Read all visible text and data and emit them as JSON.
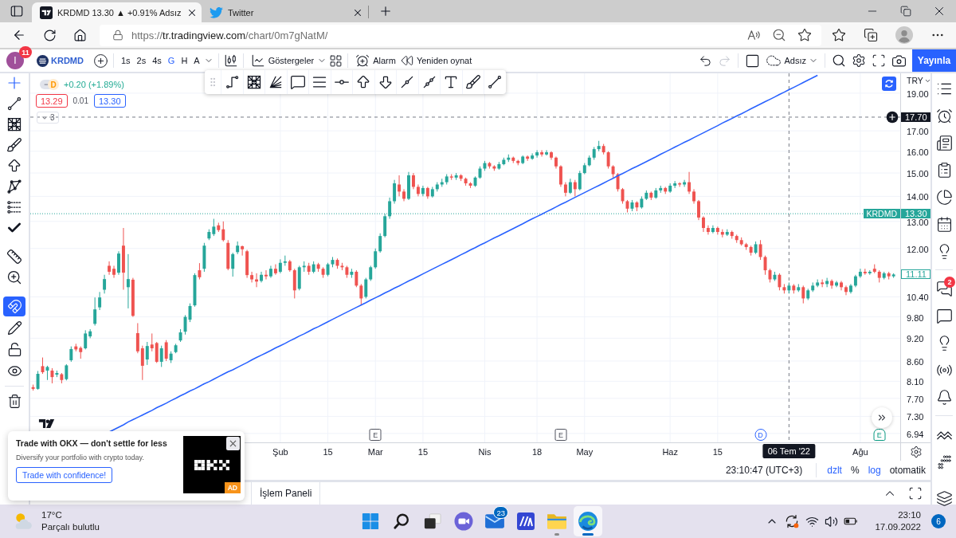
{
  "browser": {
    "tabs": [
      {
        "kind": "tradingview",
        "title": "KRDMD 13.30 ▲ +0.91% Adsız",
        "selected": true
      },
      {
        "kind": "twitter",
        "title": "Twitter",
        "selected": false
      }
    ],
    "address": {
      "scheme": "https://",
      "host": "tr.tradingview.com",
      "path": "/chart/0m7gNatM/"
    }
  },
  "toolbar": {
    "user": {
      "initial": "I",
      "badge": "11"
    },
    "symbol": "KRDMD",
    "intervals": [
      {
        "label": "1s",
        "selected": false
      },
      {
        "label": "2s",
        "selected": false
      },
      {
        "label": "4s",
        "selected": false
      },
      {
        "label": "G",
        "selected": true
      },
      {
        "label": "H",
        "selected": false
      },
      {
        "label": "A",
        "selected": false
      }
    ],
    "indicators": "Göstergeler",
    "alarm": "Alarm",
    "replay": "Yeniden oynat",
    "history": [
      {
        "kind": "undo",
        "disabled": false
      },
      {
        "kind": "redo",
        "disabled": true
      }
    ],
    "layout": "Adsız",
    "publish": "Yayınla"
  },
  "left_toolbar": {
    "groups": [
      {
        "tools": [
          {
            "kind": "crosshair",
            "selected": true
          },
          {
            "kind": "trend-line",
            "selected": false
          },
          {
            "kind": "fib-grid",
            "selected": false
          },
          {
            "kind": "brush",
            "selected": false
          },
          {
            "kind": "arrow",
            "selected": false
          },
          {
            "kind": "pattern",
            "selected": false
          },
          {
            "kind": "projection",
            "selected": false
          },
          {
            "kind": "check",
            "selected": false
          }
        ]
      },
      {
        "tools": [
          {
            "kind": "ruler",
            "selected": false
          },
          {
            "kind": "zoom",
            "selected": false
          }
        ]
      },
      {
        "tools": [
          {
            "kind": "magnet",
            "on": true
          },
          {
            "kind": "pencil-lock",
            "on": false
          },
          {
            "kind": "lock",
            "on": false
          },
          {
            "kind": "eye",
            "on": false
          }
        ]
      }
    ]
  },
  "chart": {
    "legend": {
      "status": "D",
      "change": "+0.20 (+1.89%)",
      "bid": "13.29",
      "spread": "0.01",
      "ask": "13.30",
      "collapsed_count": "3"
    },
    "currency": "TRY",
    "symbol_tag": "KRDMD",
    "last_value": "11.11",
    "crosshair_date": "06 Tem '22",
    "chart_data": {
      "type": "candlestick",
      "log": true,
      "grid": true,
      "ylim": [
        6.76,
        20.15
      ],
      "yticks": [
        {
          "value": 19,
          "label": "19.00"
        },
        {
          "value": 17,
          "label": "17.00"
        },
        {
          "value": 16,
          "label": "16.00"
        },
        {
          "value": 15,
          "label": "15.00"
        },
        {
          "value": 14,
          "label": "14.00"
        },
        {
          "value": 13,
          "label": "13.00"
        },
        {
          "value": 12,
          "label": "12.00"
        },
        {
          "value": 10.4,
          "label": "10.40"
        },
        {
          "value": 9.8,
          "label": "9.80"
        },
        {
          "value": 9.2,
          "label": "9.20"
        },
        {
          "value": 8.6,
          "label": "8.60"
        },
        {
          "value": 8.1,
          "label": "8.10"
        },
        {
          "value": 7.7,
          "label": "7.70"
        },
        {
          "value": 7.3,
          "label": "7.30"
        },
        {
          "value": 6.94,
          "label": "6.94"
        }
      ],
      "categories": [
        null,
        null,
        null,
        null,
        null,
        null,
        null,
        null,
        null,
        null,
        null,
        null,
        null,
        null,
        null,
        null,
        null,
        null,
        null,
        null,
        null,
        null,
        null,
        null,
        null,
        null,
        null,
        null,
        null,
        null,
        null,
        null,
        null,
        null,
        null,
        null,
        null,
        null,
        null,
        null,
        null,
        null,
        null,
        null,
        null,
        null,
        null,
        null,
        null,
        null,
        null,
        null,
        "Şub",
        null,
        null,
        null,
        null,
        null,
        null,
        null,
        null,
        null,
        "15",
        null,
        null,
        null,
        null,
        null,
        null,
        null,
        null,
        null,
        "Mar",
        null,
        null,
        null,
        null,
        null,
        null,
        null,
        null,
        null,
        "15",
        null,
        null,
        null,
        null,
        null,
        null,
        null,
        null,
        null,
        null,
        null,
        null,
        "Nis",
        null,
        null,
        null,
        null,
        null,
        null,
        null,
        null,
        null,
        null,
        "18",
        null,
        null,
        null,
        null,
        null,
        null,
        null,
        null,
        null,
        "May",
        null,
        null,
        null,
        null,
        null,
        null,
        null,
        null,
        null,
        null,
        null,
        null,
        null,
        null,
        null,
        null,
        null,
        "Haz",
        null,
        null,
        null,
        null,
        null,
        null,
        null,
        null,
        null,
        "15",
        null,
        null,
        null,
        null,
        null,
        null,
        null,
        null,
        null,
        null,
        null,
        null,
        null,
        null,
        null,
        null,
        null,
        null,
        null,
        null,
        null,
        null,
        null,
        null,
        null,
        null,
        null,
        null,
        null,
        "Ağu",
        null,
        null,
        null,
        null,
        null,
        null,
        null
      ],
      "ohlc": [
        [
          7.96,
          8.02,
          7.88,
          7.92
        ],
        [
          7.92,
          8.35,
          7.9,
          8.28
        ],
        [
          8.47,
          8.69,
          8.28,
          8.32
        ],
        [
          8.36,
          8.48,
          8.13,
          8.45
        ],
        [
          8.36,
          8.42,
          8.05,
          8.2
        ],
        [
          8.26,
          8.36,
          8.2,
          8.3
        ],
        [
          8.27,
          8.3,
          8.05,
          8.13
        ],
        [
          8.15,
          8.52,
          8.12,
          8.49
        ],
        [
          8.62,
          8.98,
          8.58,
          8.91
        ],
        [
          8.98,
          9.05,
          8.85,
          8.9
        ],
        [
          8.94,
          8.98,
          8.66,
          8.83
        ],
        [
          8.93,
          9.42,
          8.9,
          9.33
        ],
        [
          9.25,
          9.45,
          9.2,
          9.39
        ],
        [
          9.6,
          10.38,
          9.55,
          10.02
        ],
        [
          10.08,
          10.55,
          10.0,
          10.38
        ],
        [
          10.62,
          11.1,
          10.5,
          10.96
        ],
        [
          11.4,
          11.55,
          11.1,
          11.2
        ],
        [
          11.3,
          11.4,
          11.0,
          11.1
        ],
        [
          11.17,
          11.9,
          11.1,
          11.82
        ],
        [
          12.1,
          12.75,
          10.62,
          11.17
        ],
        [
          10.7,
          11.8,
          10.05,
          10.96
        ],
        [
          10.94,
          11.0,
          9.8,
          9.83
        ],
        [
          9.34,
          9.62,
          8.8,
          8.85
        ],
        [
          8.93,
          9.0,
          8.13,
          8.48
        ],
        [
          8.64,
          9.1,
          8.5,
          8.99
        ],
        [
          9.03,
          9.33,
          8.85,
          8.93
        ],
        [
          9.07,
          9.1,
          8.55,
          8.58
        ],
        [
          8.58,
          9.0,
          8.45,
          8.93
        ],
        [
          9.09,
          9.15,
          8.6,
          8.66
        ],
        [
          8.62,
          8.85,
          8.55,
          8.79
        ],
        [
          8.83,
          9.05,
          8.8,
          9.01
        ],
        [
          9.14,
          9.45,
          9.1,
          9.36
        ],
        [
          9.38,
          9.85,
          9.3,
          9.8
        ],
        [
          9.72,
          10.2,
          9.65,
          10.12
        ],
        [
          10.14,
          11.15,
          10.1,
          11.09
        ],
        [
          11.25,
          11.49,
          10.95,
          11.02
        ],
        [
          11.3,
          12.2,
          11.2,
          12.1
        ],
        [
          12.36,
          12.7,
          12.3,
          12.6
        ],
        [
          12.52,
          13.1,
          12.45,
          12.8
        ],
        [
          12.85,
          12.95,
          12.6,
          12.67
        ],
        [
          12.7,
          13.0,
          12.25,
          12.3
        ],
        [
          12.2,
          12.3,
          11.25,
          11.3
        ],
        [
          11.3,
          11.85,
          11.04,
          11.8
        ],
        [
          11.87,
          12.25,
          11.8,
          12.1
        ],
        [
          12.08,
          12.1,
          11.75,
          11.97
        ],
        [
          11.9,
          11.95,
          11.0,
          11.09
        ],
        [
          11.09,
          11.2,
          10.85,
          10.95
        ],
        [
          10.95,
          11.15,
          10.7,
          10.88
        ],
        [
          10.9,
          11.2,
          10.85,
          11.1
        ],
        [
          11.1,
          11.25,
          10.95,
          11.05
        ],
        [
          11.05,
          11.4,
          11.0,
          11.3
        ],
        [
          11.3,
          11.45,
          11.1,
          11.15
        ],
        [
          11.2,
          11.62,
          11.15,
          11.5
        ],
        [
          11.5,
          11.75,
          11.4,
          11.55
        ],
        [
          11.55,
          11.6,
          11.2,
          11.25
        ],
        [
          11.25,
          11.3,
          10.35,
          10.6
        ],
        [
          10.65,
          11.4,
          10.6,
          11.35
        ],
        [
          11.35,
          11.55,
          11.2,
          11.4
        ],
        [
          11.4,
          11.5,
          11.1,
          11.2
        ],
        [
          11.2,
          11.55,
          11.15,
          11.45
        ],
        [
          11.45,
          11.5,
          11.2,
          11.3
        ],
        [
          11.3,
          11.35,
          11.0,
          11.1
        ],
        [
          11.1,
          11.5,
          11.05,
          11.45
        ],
        [
          11.45,
          11.7,
          11.35,
          11.6
        ],
        [
          11.6,
          11.65,
          11.3,
          11.4
        ],
        [
          11.4,
          11.5,
          11.25,
          11.35
        ],
        [
          11.35,
          11.4,
          11.0,
          11.1
        ],
        [
          11.1,
          11.3,
          11.0,
          11.2
        ],
        [
          11.2,
          11.25,
          10.7,
          10.75
        ],
        [
          10.75,
          10.8,
          10.14,
          10.35
        ],
        [
          10.4,
          11.0,
          10.35,
          10.95
        ],
        [
          10.95,
          11.4,
          10.9,
          11.35
        ],
        [
          11.35,
          12.0,
          11.3,
          11.9
        ],
        [
          11.9,
          12.55,
          11.85,
          12.45
        ],
        [
          12.45,
          13.3,
          12.4,
          13.2
        ],
        [
          13.2,
          13.95,
          13.1,
          13.8
        ],
        [
          13.8,
          14.7,
          13.7,
          14.55
        ],
        [
          14.5,
          14.9,
          14.0,
          14.2
        ],
        [
          14.2,
          14.3,
          13.8,
          13.9
        ],
        [
          13.9,
          15.05,
          13.85,
          14.9
        ],
        [
          14.9,
          15.0,
          14.3,
          14.4
        ],
        [
          14.4,
          14.5,
          14.0,
          14.1
        ],
        [
          14.1,
          14.45,
          14.0,
          14.35
        ],
        [
          14.35,
          14.4,
          13.9,
          14.0
        ],
        [
          14.0,
          14.4,
          13.95,
          14.3
        ],
        [
          14.3,
          14.6,
          14.2,
          14.5
        ],
        [
          14.5,
          14.75,
          14.4,
          14.6
        ],
        [
          14.6,
          14.95,
          14.5,
          14.85
        ],
        [
          14.85,
          14.95,
          14.7,
          14.8
        ],
        [
          14.8,
          15.0,
          14.7,
          14.9
        ],
        [
          14.9,
          14.95,
          14.65,
          14.75
        ],
        [
          14.75,
          14.8,
          14.45,
          14.55
        ],
        [
          14.55,
          14.6,
          14.35,
          14.45
        ],
        [
          14.45,
          14.85,
          14.4,
          14.8
        ],
        [
          14.8,
          15.3,
          14.75,
          15.2
        ],
        [
          15.2,
          15.55,
          15.1,
          15.45
        ],
        [
          15.45,
          15.5,
          15.2,
          15.3
        ],
        [
          15.3,
          15.35,
          15.1,
          15.2
        ],
        [
          15.2,
          15.5,
          15.15,
          15.4
        ],
        [
          15.4,
          15.7,
          15.35,
          15.6
        ],
        [
          15.6,
          15.85,
          15.5,
          15.7
        ],
        [
          15.7,
          15.75,
          15.45,
          15.55
        ],
        [
          15.55,
          15.6,
          15.35,
          15.45
        ],
        [
          15.45,
          15.8,
          15.4,
          15.75
        ],
        [
          15.75,
          15.8,
          15.55,
          15.65
        ],
        [
          15.65,
          15.9,
          15.6,
          15.8
        ],
        [
          15.8,
          16.05,
          15.7,
          15.95
        ],
        [
          15.95,
          16.05,
          15.75,
          15.85
        ],
        [
          15.85,
          16.05,
          15.8,
          15.95
        ],
        [
          15.95,
          16.0,
          15.6,
          15.7
        ],
        [
          15.7,
          15.75,
          15.2,
          15.3
        ],
        [
          15.3,
          15.35,
          14.4,
          14.5
        ],
        [
          14.5,
          14.6,
          14.0,
          14.15
        ],
        [
          14.15,
          14.75,
          14.1,
          14.6
        ],
        [
          14.6,
          14.7,
          14.0,
          14.3
        ],
        [
          14.3,
          15.1,
          14.25,
          15.0
        ],
        [
          15.0,
          15.45,
          14.95,
          15.35
        ],
        [
          15.35,
          15.8,
          15.3,
          15.7
        ],
        [
          15.7,
          16.2,
          15.6,
          16.1
        ],
        [
          16.1,
          16.5,
          16.0,
          16.25
        ],
        [
          16.25,
          16.35,
          15.85,
          15.95
        ],
        [
          15.95,
          16.0,
          15.2,
          15.3
        ],
        [
          15.3,
          15.35,
          14.8,
          14.95
        ],
        [
          14.95,
          15.0,
          14.2,
          14.3
        ],
        [
          14.3,
          14.35,
          13.7,
          13.8
        ],
        [
          13.8,
          13.85,
          13.35,
          13.5
        ],
        [
          13.5,
          13.85,
          13.4,
          13.75
        ],
        [
          13.75,
          13.8,
          13.4,
          13.55
        ],
        [
          13.55,
          14.0,
          13.5,
          13.9
        ],
        [
          13.9,
          14.25,
          13.85,
          14.15
        ],
        [
          14.15,
          14.2,
          13.85,
          13.95
        ],
        [
          13.95,
          14.35,
          13.9,
          14.25
        ],
        [
          14.25,
          14.45,
          14.15,
          14.35
        ],
        [
          14.35,
          14.4,
          14.1,
          14.2
        ],
        [
          14.2,
          14.55,
          14.15,
          14.45
        ],
        [
          14.45,
          14.65,
          14.35,
          14.55
        ],
        [
          14.55,
          14.6,
          14.4,
          14.5
        ],
        [
          14.5,
          14.7,
          14.4,
          14.6
        ],
        [
          14.6,
          15.05,
          14.1,
          14.2
        ],
        [
          14.2,
          14.3,
          13.7,
          13.8
        ],
        [
          13.8,
          13.85,
          13.05,
          13.15
        ],
        [
          13.15,
          13.2,
          12.6,
          12.75
        ],
        [
          12.75,
          12.85,
          12.5,
          12.6
        ],
        [
          12.6,
          12.85,
          12.55,
          12.75
        ],
        [
          12.75,
          12.8,
          12.5,
          12.6
        ],
        [
          12.6,
          12.7,
          12.4,
          12.5
        ],
        [
          12.5,
          12.7,
          12.45,
          12.6
        ],
        [
          12.6,
          12.65,
          12.35,
          12.45
        ],
        [
          12.45,
          12.5,
          12.2,
          12.3
        ],
        [
          12.3,
          12.4,
          12.1,
          12.15
        ],
        [
          12.15,
          12.2,
          11.95,
          12.05
        ],
        [
          12.05,
          12.1,
          11.75,
          11.85
        ],
        [
          11.85,
          12.25,
          11.8,
          12.15
        ],
        [
          12.15,
          12.3,
          11.6,
          11.7
        ],
        [
          11.7,
          11.75,
          11.1,
          11.25
        ],
        [
          11.25,
          11.3,
          10.85,
          10.95
        ],
        [
          10.95,
          11.2,
          10.9,
          11.1
        ],
        [
          11.1,
          11.15,
          10.6,
          10.7
        ],
        [
          10.7,
          10.8,
          10.5,
          10.6
        ],
        [
          10.6,
          10.85,
          10.5,
          10.75
        ],
        [
          10.75,
          10.8,
          10.5,
          10.6
        ],
        [
          10.6,
          10.8,
          10.55,
          10.7
        ],
        [
          10.7,
          10.75,
          10.2,
          10.35
        ],
        [
          10.35,
          10.65,
          10.3,
          10.6
        ],
        [
          10.6,
          10.85,
          10.55,
          10.75
        ],
        [
          10.75,
          10.95,
          10.7,
          10.85
        ],
        [
          10.85,
          10.95,
          10.7,
          10.8
        ],
        [
          10.8,
          11.0,
          10.7,
          10.9
        ],
        [
          10.9,
          10.95,
          10.65,
          10.75
        ],
        [
          10.75,
          10.9,
          10.7,
          10.85
        ],
        [
          10.85,
          10.9,
          10.6,
          10.7
        ],
        [
          10.7,
          10.75,
          10.45,
          10.55
        ],
        [
          10.55,
          10.8,
          10.5,
          10.75
        ],
        [
          10.75,
          11.1,
          10.7,
          11.05
        ],
        [
          11.05,
          11.3,
          11.0,
          11.2
        ],
        [
          11.2,
          11.3,
          11.1,
          11.15
        ],
        [
          11.15,
          11.25,
          11.1,
          11.2
        ],
        [
          11.3,
          11.45,
          11.15,
          11.2
        ],
        [
          11.2,
          11.25,
          10.85,
          11.0
        ],
        [
          11.0,
          11.2,
          10.95,
          11.15
        ],
        [
          11.15,
          11.2,
          10.95,
          11.05
        ],
        [
          11.05,
          11.15,
          11.0,
          11.11
        ]
      ],
      "series": [
        {
          "type": "line",
          "color": "#2962ff",
          "values": [
            null,
            null,
            null,
            null,
            null,
            null,
            null,
            null,
            null,
            null,
            null,
            null,
            null,
            null,
            null,
            null,
            6.97,
            7.02,
            7.07,
            7.12,
            7.18,
            7.23,
            7.28,
            7.33,
            7.38,
            7.43,
            7.49,
            7.54,
            7.59,
            7.65,
            7.7,
            7.76,
            7.81,
            7.87,
            7.92,
            7.98,
            8.04,
            8.09,
            8.15,
            8.21,
            8.27,
            8.33,
            8.38,
            8.44,
            8.5,
            8.56,
            8.63,
            8.69,
            8.75,
            8.81,
            8.87,
            8.94,
            9.0,
            9.06,
            9.13,
            9.19,
            9.26,
            9.32,
            9.39,
            9.46,
            9.52,
            9.59,
            9.66,
            9.73,
            9.8,
            9.87,
            9.94,
            10.01,
            10.08,
            10.15,
            10.22,
            10.3,
            10.37,
            10.44,
            10.52,
            10.59,
            10.67,
            10.74,
            10.82,
            10.9,
            10.97,
            11.05,
            11.13,
            11.21,
            11.29,
            11.37,
            11.45,
            11.53,
            11.61,
            11.69,
            11.78,
            11.86,
            11.95,
            12.03,
            12.12,
            12.2,
            12.29,
            12.38,
            12.46,
            12.55,
            12.64,
            12.73,
            12.82,
            12.91,
            13.01,
            13.1,
            13.19,
            13.28,
            13.38,
            13.47,
            13.57,
            13.67,
            13.76,
            13.86,
            13.96,
            14.06,
            14.16,
            14.26,
            14.36,
            14.46,
            14.56,
            14.67,
            14.77,
            14.88,
            14.98,
            15.09,
            15.2,
            15.3,
            15.41,
            15.52,
            15.63,
            15.74,
            15.86,
            15.97,
            16.08,
            16.2,
            16.31,
            16.43,
            16.54,
            16.66,
            16.78,
            16.9,
            17.02,
            17.14,
            17.26,
            17.39,
            17.51,
            17.63,
            17.76,
            17.88,
            18.01,
            18.14,
            18.27,
            18.4,
            18.53,
            18.66,
            18.79,
            18.93,
            19.06,
            19.2,
            19.33,
            19.47,
            19.61,
            19.75,
            19.89,
            20.03,
            null,
            null,
            null,
            null,
            null,
            null,
            null,
            null,
            null,
            null,
            null,
            null,
            null,
            null,
            null,
            null
          ]
        }
      ],
      "ref_lines": [
        {
          "axis": "y",
          "value": 17.7,
          "label": "17.70",
          "color": "#787b86",
          "line_style": "dashed"
        },
        {
          "axis": "y",
          "value": 13.3,
          "label": "13.30",
          "color": "#26a69a",
          "line_style": "dotted"
        }
      ]
    },
    "events": [
      {
        "kind": "earnings",
        "label": "E"
      },
      {
        "kind": "earnings",
        "label": "E"
      },
      {
        "kind": "dividend",
        "label": "D"
      },
      {
        "kind": "upcoming",
        "label": "E"
      }
    ]
  },
  "right_sidebar": {
    "chat_badge": "2"
  },
  "status_bar": {
    "time": "23:10:47 (UTC+3)",
    "toggles": [
      {
        "label": "dzlt",
        "on": true
      },
      {
        "label": "%",
        "on": false
      },
      {
        "label": "log",
        "on": true
      },
      {
        "label": "otomatik",
        "on": false
      }
    ]
  },
  "bottom_panel": {
    "tabs": [
      {
        "label": "İşlem Paneli",
        "selected": false
      }
    ]
  },
  "ad": {
    "title": "Trade with OKX — don't settle for less",
    "text": "Diversify your portfolio with crypto today.",
    "button": "Trade with confidence!",
    "badge": "AD"
  },
  "taskbar": {
    "weather": {
      "temperature": "17°C",
      "condition": "Parçalı bulutlu"
    },
    "apps": [
      {
        "kind": "start",
        "running": false,
        "selected": false
      },
      {
        "kind": "search",
        "running": false,
        "selected": false
      },
      {
        "kind": "task-view",
        "running": false,
        "selected": false
      },
      {
        "kind": "chat",
        "running": false,
        "selected": false
      },
      {
        "kind": "mail",
        "badge": "23",
        "running": false,
        "selected": false
      },
      {
        "kind": "app",
        "running": false,
        "selected": false
      },
      {
        "kind": "files",
        "running": true,
        "selected": false
      },
      {
        "kind": "edge",
        "running": true,
        "selected": true
      }
    ],
    "time": "23:10",
    "date": "17.09.2022",
    "notifications": "6"
  }
}
